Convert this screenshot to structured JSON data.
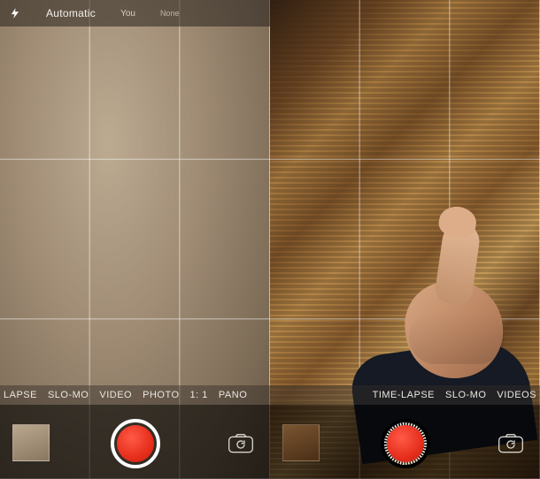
{
  "left": {
    "flash_mode_icon": "flash-icon",
    "hdr_label": "Automatic",
    "hdr_sub1": "You",
    "hdr_sub2": "None",
    "modes": [
      "LAPSE",
      "SLO-MO",
      "VIDEO",
      "PHOTO",
      "1: 1",
      "PANO"
    ],
    "accent": "#e62e1c"
  },
  "right": {
    "modes": [
      "TIME-LAPSE",
      "SLO-MO",
      "VIDEOS"
    ],
    "accent": "#e62e1c"
  }
}
